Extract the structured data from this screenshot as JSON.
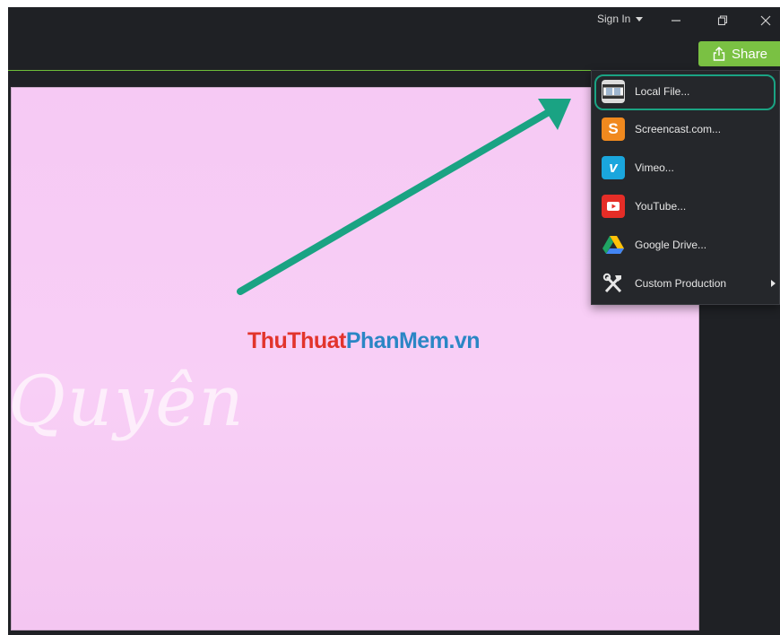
{
  "header": {
    "sign_in_label": "Sign In",
    "share_label": "Share",
    "window_controls": [
      "minimize-icon",
      "restore-icon",
      "close-icon"
    ]
  },
  "canvas": {
    "script_text": "Quyên",
    "watermark_part1": "ThuThuat",
    "watermark_part2": "PhanMem.vn",
    "background_color": "#f7ccf5"
  },
  "share_menu": {
    "items": [
      {
        "label": "Local File...",
        "icon": "film-strip-icon"
      },
      {
        "label": "Screencast.com...",
        "icon": "screencast-icon"
      },
      {
        "label": "Vimeo...",
        "icon": "vimeo-icon"
      },
      {
        "label": "YouTube...",
        "icon": "youtube-icon"
      },
      {
        "label": "Google Drive...",
        "icon": "google-drive-icon"
      },
      {
        "label": "Custom Production",
        "icon": "tools-icon",
        "has_submenu": true
      }
    ]
  },
  "colors": {
    "accent_green": "#7ac143",
    "annotation_teal": "#1aa383",
    "dark_bg": "#1f2125"
  }
}
